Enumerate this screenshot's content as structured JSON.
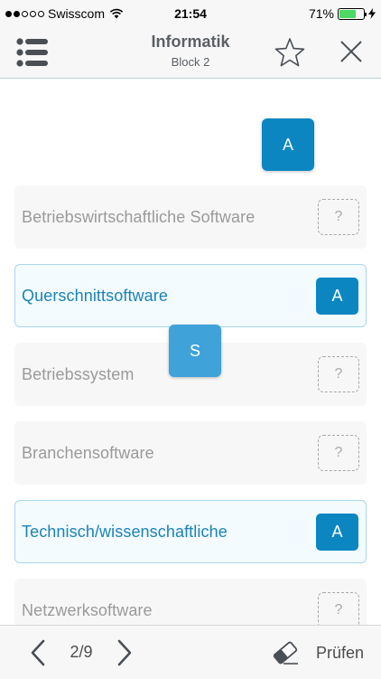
{
  "status_bar": {
    "carrier": "Swisscom",
    "time": "21:54",
    "battery_percent": "71%",
    "battery_level": 0.71,
    "signal_bars_filled": 2,
    "signal_bars_total": 5
  },
  "nav": {
    "title": "Informatik",
    "subtitle": "Block 2",
    "menu_icon": "list-menu-icon",
    "favorite_icon": "star-icon",
    "close_icon": "close-icon"
  },
  "tiles": [
    {
      "label": "A"
    },
    {
      "label": "S"
    }
  ],
  "answers": [
    {
      "text": "Betriebswirtschaftliche Software",
      "slot": "?",
      "filled": false
    },
    {
      "text": "Querschnittsoftware",
      "slot": "A",
      "filled": true
    },
    {
      "text": "Betriebssystem",
      "slot": "?",
      "filled": false
    },
    {
      "text": "Branchensoftware",
      "slot": "?",
      "filled": false
    },
    {
      "text": "Technisch/wissenschaftliche",
      "slot": "A",
      "filled": true
    },
    {
      "text": "Netzwerksoftware",
      "slot": "?",
      "filled": false
    }
  ],
  "toolbar": {
    "page_indicator": "2/9",
    "check_label": "Prüfen",
    "prev_icon": "chevron-left-icon",
    "next_icon": "chevron-right-icon",
    "eraser_icon": "eraser-icon"
  },
  "colors": {
    "accent": "#0b86c1",
    "accent_light": "#3fa2d8",
    "active_text": "#1a82b5",
    "inactive_text": "#9a9a9a"
  }
}
